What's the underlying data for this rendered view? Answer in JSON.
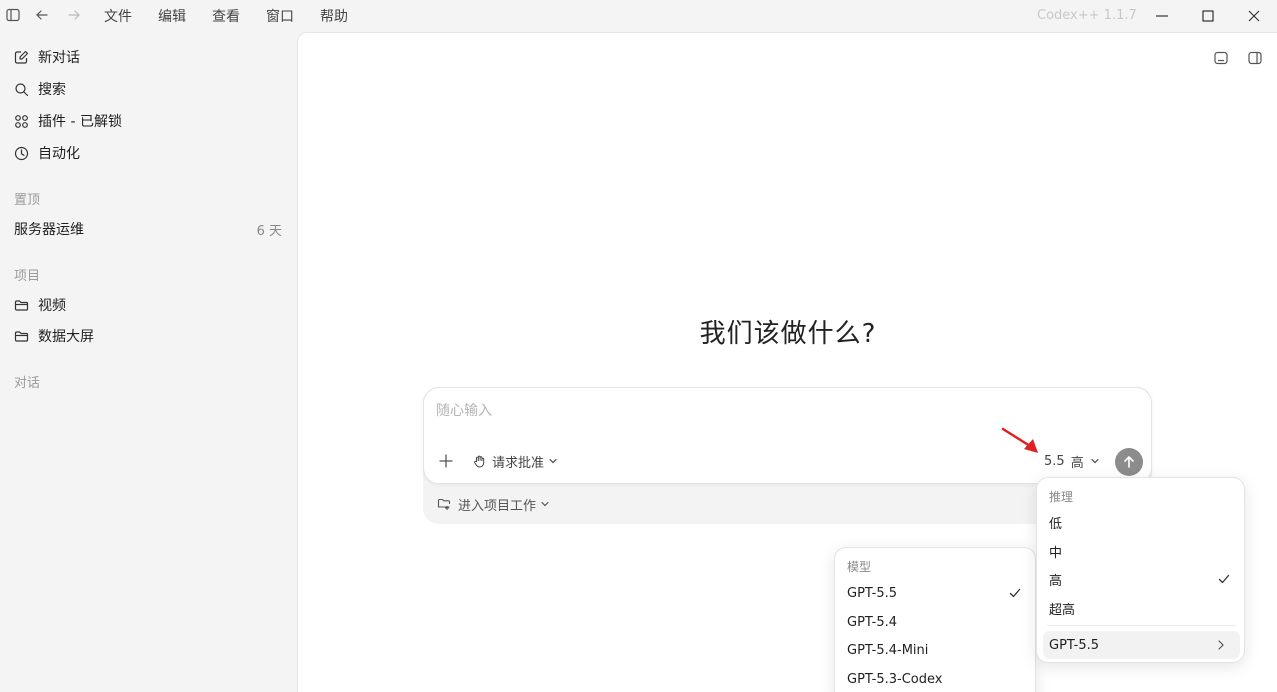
{
  "titlebar": {
    "menus": [
      "文件",
      "编辑",
      "查看",
      "窗口",
      "帮助"
    ],
    "app_title": "Codex++ 1.1.7"
  },
  "sidebar": {
    "nav": [
      {
        "label": "新对话",
        "icon": "compose-icon"
      },
      {
        "label": "搜索",
        "icon": "search-icon"
      },
      {
        "label": "插件 - 已解锁",
        "icon": "grid-icon"
      },
      {
        "label": "自动化",
        "icon": "clock-icon"
      }
    ],
    "pinned": {
      "label": "置顶",
      "items": [
        {
          "label": "服务器运维",
          "age": "6 天"
        }
      ]
    },
    "projects": {
      "label": "项目",
      "items": [
        {
          "label": "视频",
          "icon": "folder-icon"
        },
        {
          "label": "数据大屏",
          "icon": "folder-icon"
        }
      ]
    },
    "conversations": {
      "label": "对话"
    }
  },
  "main": {
    "heading": "我们该做什么?",
    "composer": {
      "placeholder": "随心输入",
      "approval_label": "请求批准",
      "model_value": "5.5",
      "reasoning_value": "高",
      "project_label": "进入项目工作"
    }
  },
  "model_menu": {
    "label": "模型",
    "items": [
      {
        "label": "GPT-5.5",
        "checked": true
      },
      {
        "label": "GPT-5.4",
        "checked": false
      },
      {
        "label": "GPT-5.4-Mini",
        "checked": false
      },
      {
        "label": "GPT-5.3-Codex",
        "checked": false
      }
    ]
  },
  "reasoning_menu": {
    "label": "推理",
    "items": [
      {
        "label": "低",
        "checked": false
      },
      {
        "label": "中",
        "checked": false
      },
      {
        "label": "高",
        "checked": true
      },
      {
        "label": "超高",
        "checked": false
      }
    ],
    "submenu_label": "GPT-5.5"
  },
  "colors": {
    "sidebar_bg": "#f4f4f4",
    "main_bg": "#ffffff",
    "send_button": "#8c8c8c",
    "annotation_arrow": "#e02020"
  }
}
